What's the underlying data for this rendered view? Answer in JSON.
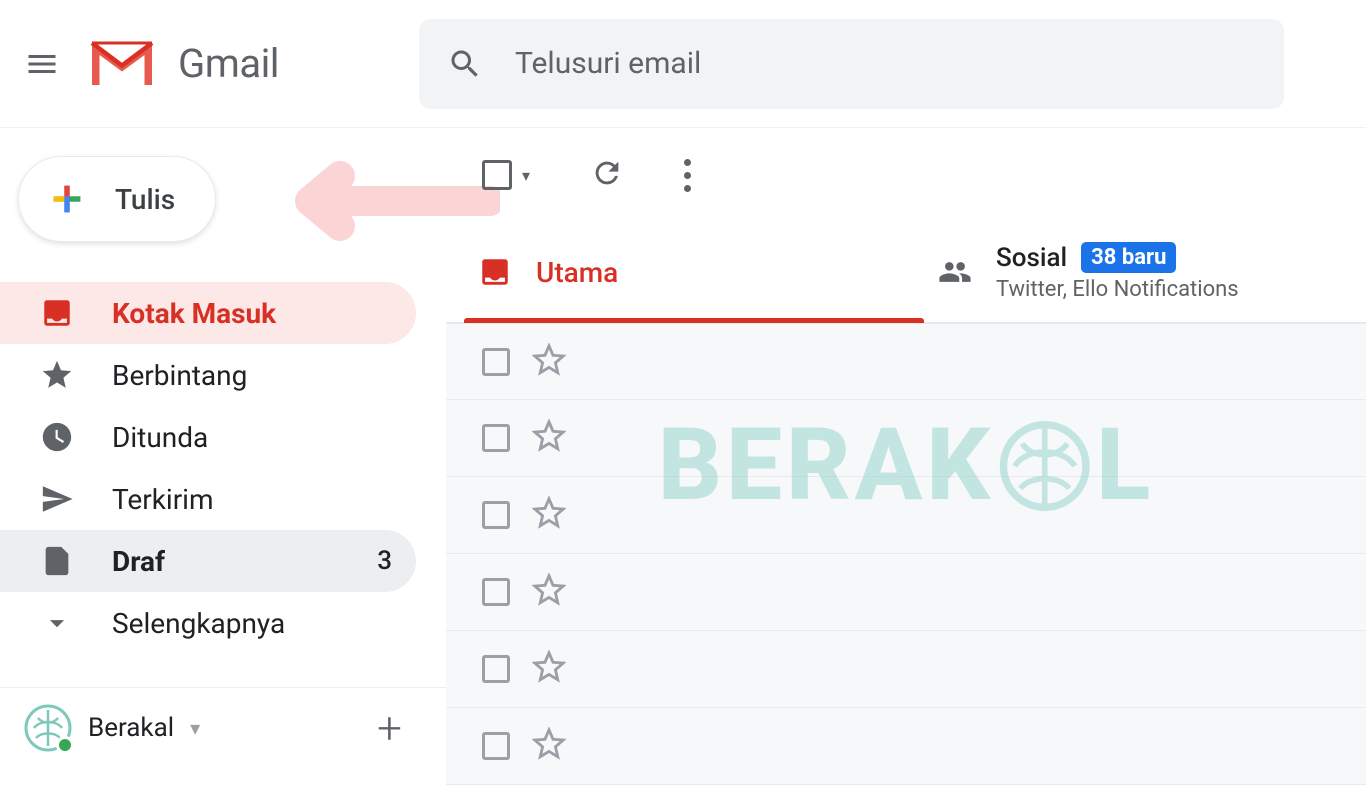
{
  "header": {
    "brand": "Gmail",
    "search_placeholder": "Telusuri email"
  },
  "compose": {
    "label": "Tulis"
  },
  "nav": {
    "inbox": "Kotak Masuk",
    "starred": "Berbintang",
    "snoozed": "Ditunda",
    "sent": "Terkirim",
    "drafts": "Draf",
    "drafts_count": "3",
    "more": "Selengkapnya"
  },
  "hangout": {
    "name": "Berakal"
  },
  "tabs": {
    "primary": "Utama",
    "social": "Sosial",
    "social_badge": "38 baru",
    "social_sub": "Twitter, Ello Notifications"
  },
  "watermark": {
    "pre": "BERAK",
    "post": "L"
  }
}
